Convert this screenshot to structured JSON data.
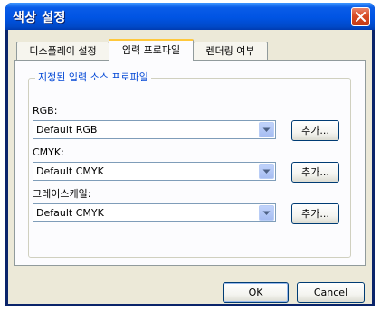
{
  "window": {
    "title": "색상 설정"
  },
  "tabs": [
    {
      "label": "디스플레이 설정",
      "active": false
    },
    {
      "label": "입력 프로파일",
      "active": true
    },
    {
      "label": "렌더링 여부",
      "active": false
    }
  ],
  "group": {
    "title": "지정된 입력 소스 프로파일",
    "rows": [
      {
        "label": "RGB:",
        "value": "Default RGB",
        "button": "추가..."
      },
      {
        "label": "CMYK:",
        "value": "Default CMYK",
        "button": "추가..."
      },
      {
        "label": "그레이스케일:",
        "value": "Default CMYK",
        "button": "추가..."
      }
    ]
  },
  "buttons": {
    "ok": "OK",
    "cancel": "Cancel"
  },
  "icons": {
    "close": "close-icon",
    "dropdown": "chevron-down-icon"
  },
  "colors": {
    "titlebar": "#0054e3",
    "face": "#ece9d8",
    "group_title": "#0046d5",
    "close": "#d84c25"
  }
}
